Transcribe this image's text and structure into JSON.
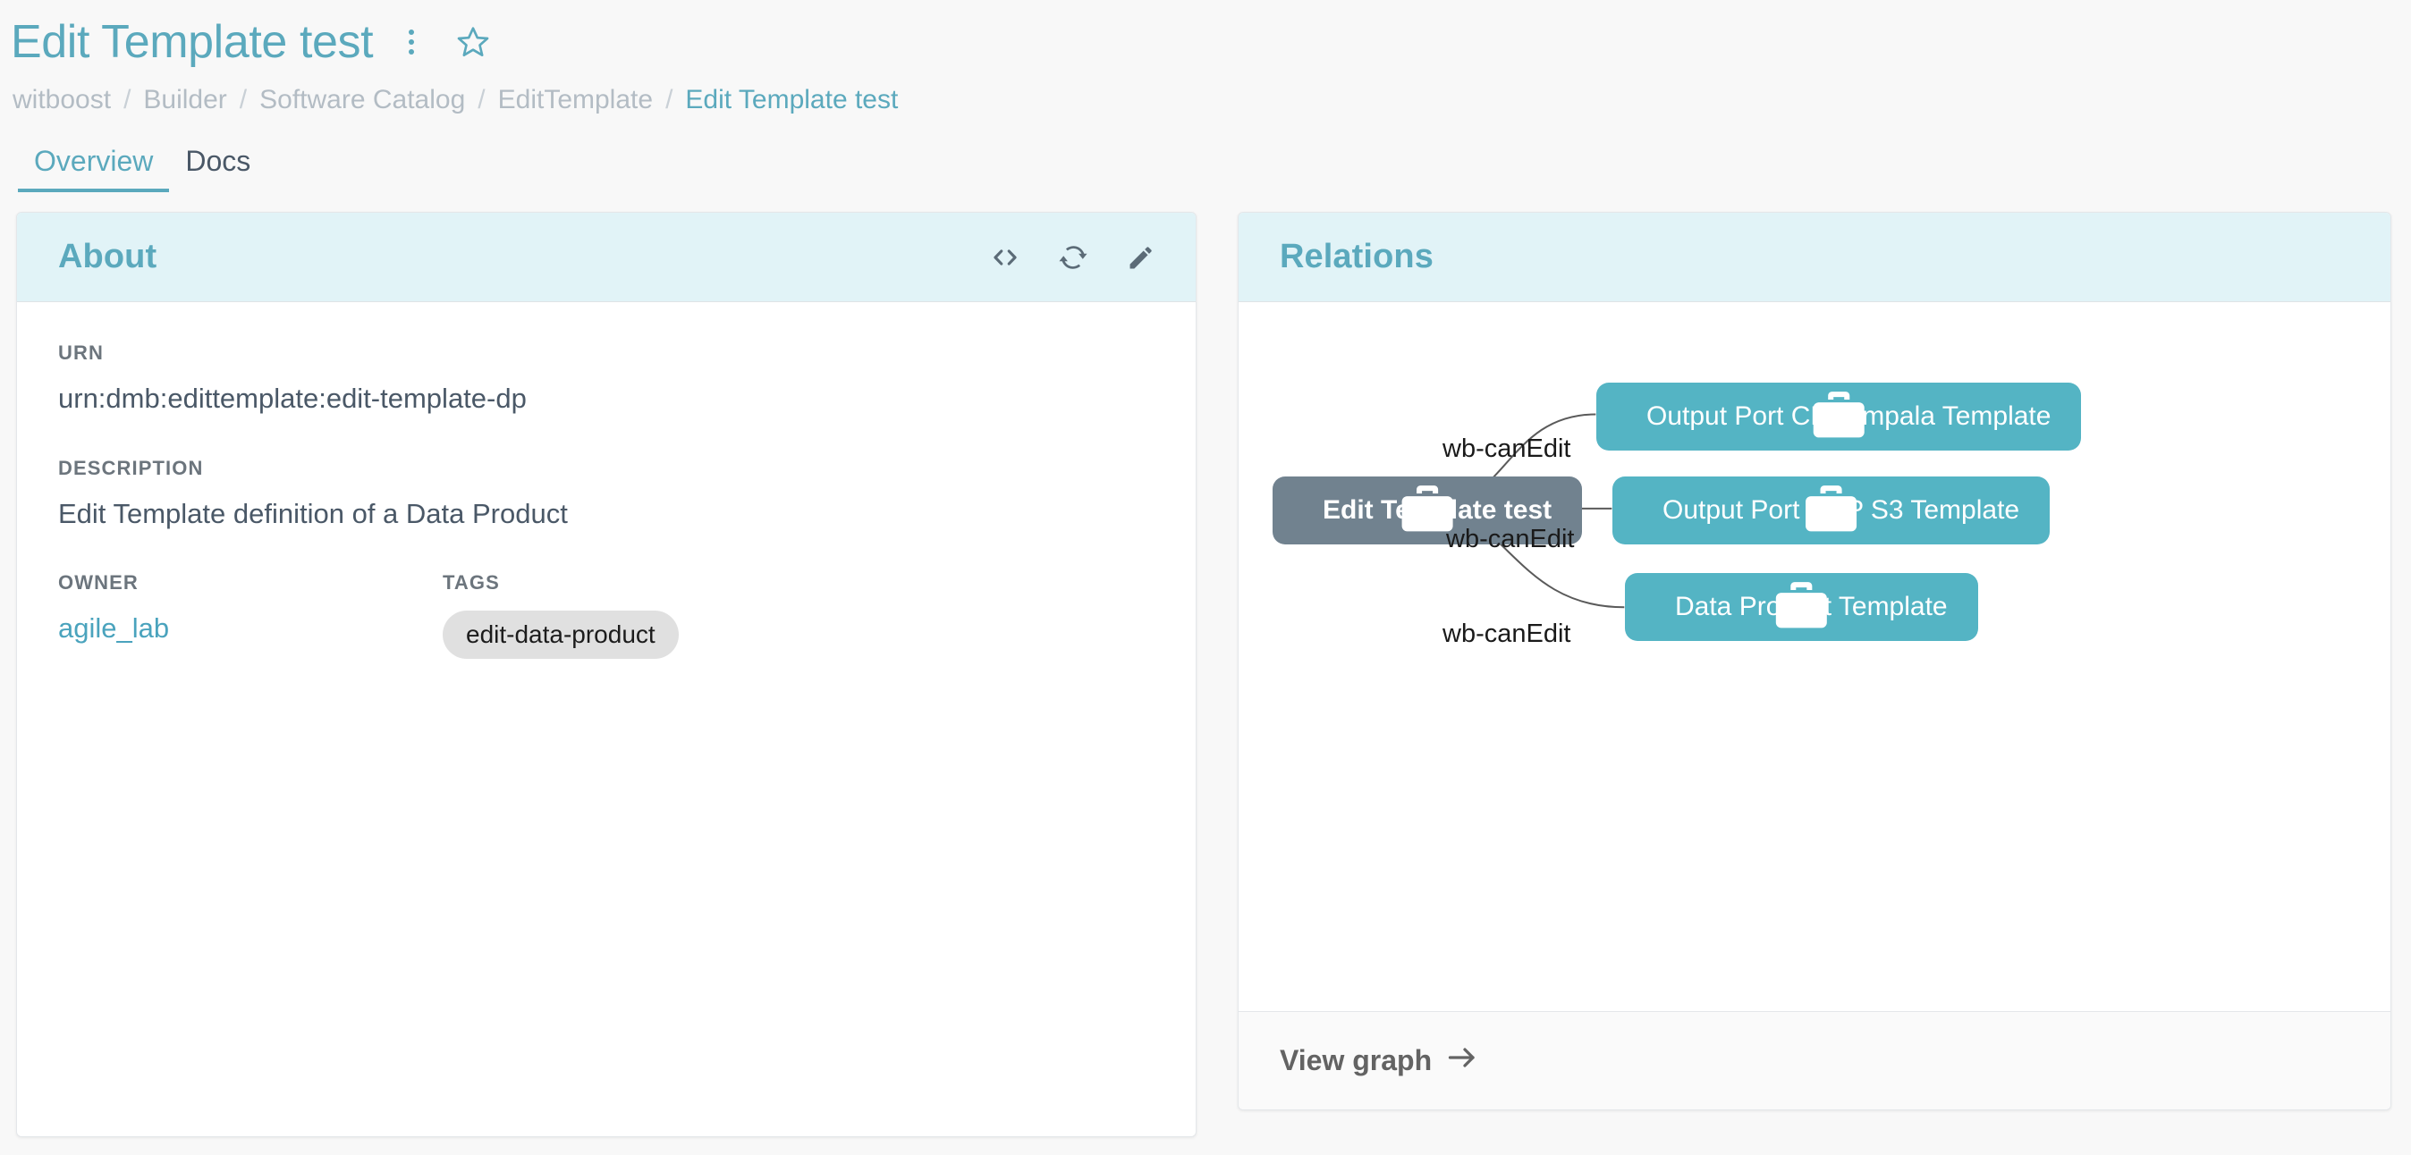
{
  "header": {
    "title": "Edit Template test",
    "kebab_icon": "more-vert-icon",
    "favorite_icon": "star-outline-icon"
  },
  "breadcrumb": {
    "separator": "/",
    "items": [
      {
        "label": "witboost",
        "current": false
      },
      {
        "label": "Builder",
        "current": false
      },
      {
        "label": "Software Catalog",
        "current": false
      },
      {
        "label": "EditTemplate",
        "current": false
      },
      {
        "label": "Edit Template test",
        "current": true
      }
    ]
  },
  "tabs": [
    {
      "label": "Overview",
      "active": true
    },
    {
      "label": "Docs",
      "active": false
    }
  ],
  "about": {
    "title": "About",
    "actions": [
      {
        "name": "view-source-button",
        "icon": "code-brackets-icon"
      },
      {
        "name": "refresh-button",
        "icon": "refresh-sync-icon"
      },
      {
        "name": "edit-button",
        "icon": "pencil-icon"
      }
    ],
    "fields": {
      "urn_label": "URN",
      "urn_value": "urn:dmb:edittemplate:edit-template-dp",
      "description_label": "DESCRIPTION",
      "description_value": "Edit Template definition of a Data Product",
      "owner_label": "OWNER",
      "owner_value": "agile_lab",
      "tags_label": "TAGS",
      "tags": [
        "edit-data-product"
      ]
    }
  },
  "relations": {
    "title": "Relations",
    "graph": {
      "node_icon": "briefcase-icon",
      "center": {
        "label": "Edit Template test",
        "color": "#71828f"
      },
      "leaves": [
        {
          "label": "Output Port CDP Impala Template",
          "color": "#54b4c4",
          "edge_label": "wb-canEdit"
        },
        {
          "label": "Output Port CDP S3 Template",
          "color": "#54b4c4",
          "edge_label": "wb-canEdit"
        },
        {
          "label": "Data Product Template",
          "color": "#54b4c4",
          "edge_label": "wb-canEdit"
        }
      ]
    },
    "footer": {
      "label": "View graph",
      "icon": "arrow-right-icon"
    }
  },
  "colors": {
    "accent": "#5ba9bd",
    "card_header_bg": "#e1f3f7",
    "node_center": "#71828f",
    "node_leaf": "#54b4c4",
    "page_bg": "#f8f8f8",
    "muted_text": "#b3bcc4"
  }
}
